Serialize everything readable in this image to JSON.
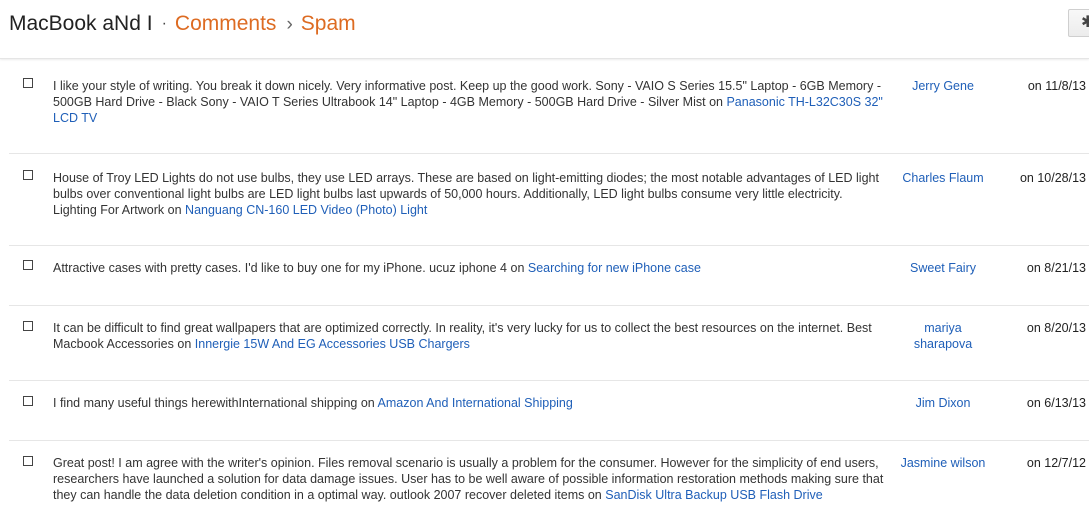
{
  "header": {
    "blog_name": "MacBook aNd I",
    "dot": "·",
    "section": "Comments",
    "separator": "›",
    "current": "Spam",
    "settings_icon": "gear-icon"
  },
  "comments": [
    {
      "text": "I like your style of writing. You break it down nicely. Very informative post. Keep up the good work. Sony - VAIO S Series 15.5\" Laptop - 6GB Memory - 500GB Hard Drive - Black Sony - VAIO T Series Ultrabook 14\" Laptop - 4GB Memory - 500GB Hard Drive - Silver Mist",
      "on": "on",
      "post": "Panasonic TH-L32C30S 32\" LCD TV",
      "author": "Jerry Gene",
      "date": "on 11/8/13"
    },
    {
      "text": "House of Troy LED Lights do not use bulbs, they use LED arrays. These are based on light-emitting diodes; the most notable advantages of LED light bulbs over conventional light bulbs are LED light bulbs last upwards of 50,000 hours. Additionally, LED light bulbs consume very little electricity. Lighting For Artwork",
      "on": "on",
      "post": "Nanguang CN-160 LED Video (Photo) Light",
      "author": "Charles Flaum",
      "date": "on 10/28/13"
    },
    {
      "text": "Attractive cases with pretty cases. I'd like to buy one for my iPhone. ucuz iphone 4",
      "on": "on",
      "post": "Searching for new iPhone case",
      "author": "Sweet Fairy",
      "date": "on 8/21/13"
    },
    {
      "text": "It can be difficult to find great wallpapers that are optimized correctly. In reality, it's very lucky for us to collect the best resources on the internet. Best Macbook Accessories",
      "on": "on",
      "post": "Innergie 15W And EG Accessories USB Chargers",
      "author": "mariya sharapova",
      "date": "on 8/20/13"
    },
    {
      "text": "I find many useful things herewithInternational shipping",
      "on": "on",
      "post": "Amazon And International Shipping",
      "author": "Jim Dixon",
      "date": "on 6/13/13"
    },
    {
      "text": "Great post! I am agree with the writer's opinion. Files removal scenario is usually a problem for the consumer. However for the simplicity of end users, researchers have launched a solution for data damage issues. User has to be well aware of possible information restoration methods making sure that they can handle the data deletion condition in a optimal way. outlook 2007 recover deleted items",
      "on": "on",
      "post": "SanDisk Ultra Backup USB Flash Drive",
      "author": "Jasmine wilson",
      "date": "on 12/7/12"
    }
  ]
}
